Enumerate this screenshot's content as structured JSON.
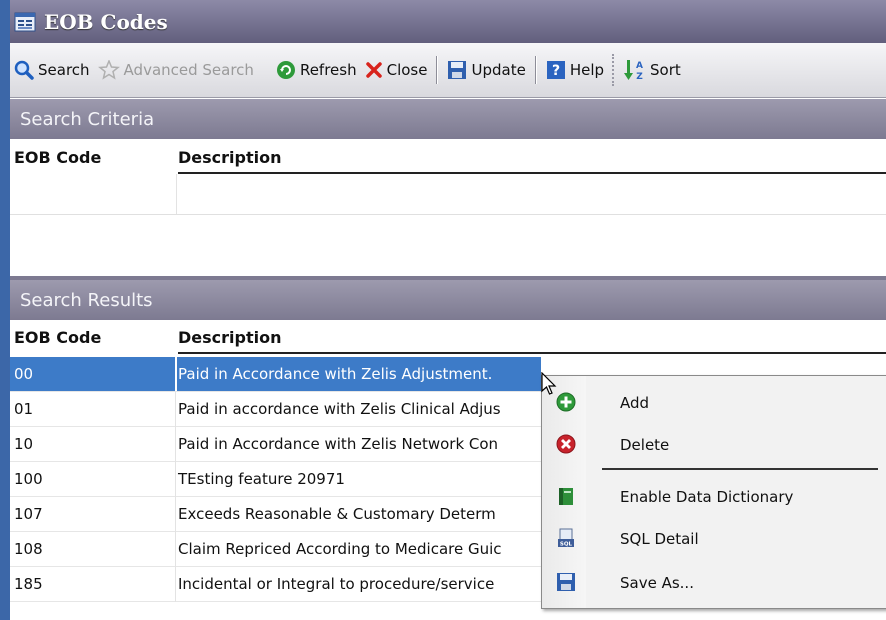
{
  "window": {
    "title": "EOB Codes"
  },
  "toolbar": {
    "search_label": "Search",
    "advanced_search_label": "Advanced Search",
    "refresh_label": "Refresh",
    "close_label": "Close",
    "update_label": "Update",
    "help_label": "Help",
    "sort_label": "Sort"
  },
  "search_criteria": {
    "header": "Search Criteria",
    "columns": [
      "EOB Code",
      "Description"
    ],
    "values": {
      "eob_code": "",
      "description": ""
    }
  },
  "search_results": {
    "header": "Search Results",
    "columns": [
      "EOB Code",
      "Description"
    ],
    "rows": [
      {
        "code": "00",
        "description": "Paid in Accordance with Zelis Adjustment."
      },
      {
        "code": "01",
        "description": "Paid in accordance with Zelis Clinical Adjus"
      },
      {
        "code": "10",
        "description": "Paid in Accordance with Zelis Network Con"
      },
      {
        "code": "100",
        "description": "TEsting feature 20971"
      },
      {
        "code": "107",
        "description": "Exceeds Reasonable & Customary Determ"
      },
      {
        "code": "108",
        "description": "Claim Repriced According to Medicare Guic"
      },
      {
        "code": "185",
        "description": "Incidental or Integral to procedure/service"
      }
    ]
  },
  "context_menu": {
    "items": [
      {
        "label": "Add",
        "icon": "add-icon"
      },
      {
        "label": "Delete",
        "icon": "delete-icon"
      },
      {
        "label": "Enable Data Dictionary",
        "icon": "data-dictionary-icon"
      },
      {
        "label": "SQL Detail",
        "icon": "sql-icon"
      },
      {
        "label": "Save As...",
        "icon": "save-icon"
      }
    ]
  },
  "colors": {
    "title_bar": "#625f7d",
    "section_header": "#7d7a91",
    "selection": "#3d7bc8",
    "window_edge": "#3c67a8"
  }
}
